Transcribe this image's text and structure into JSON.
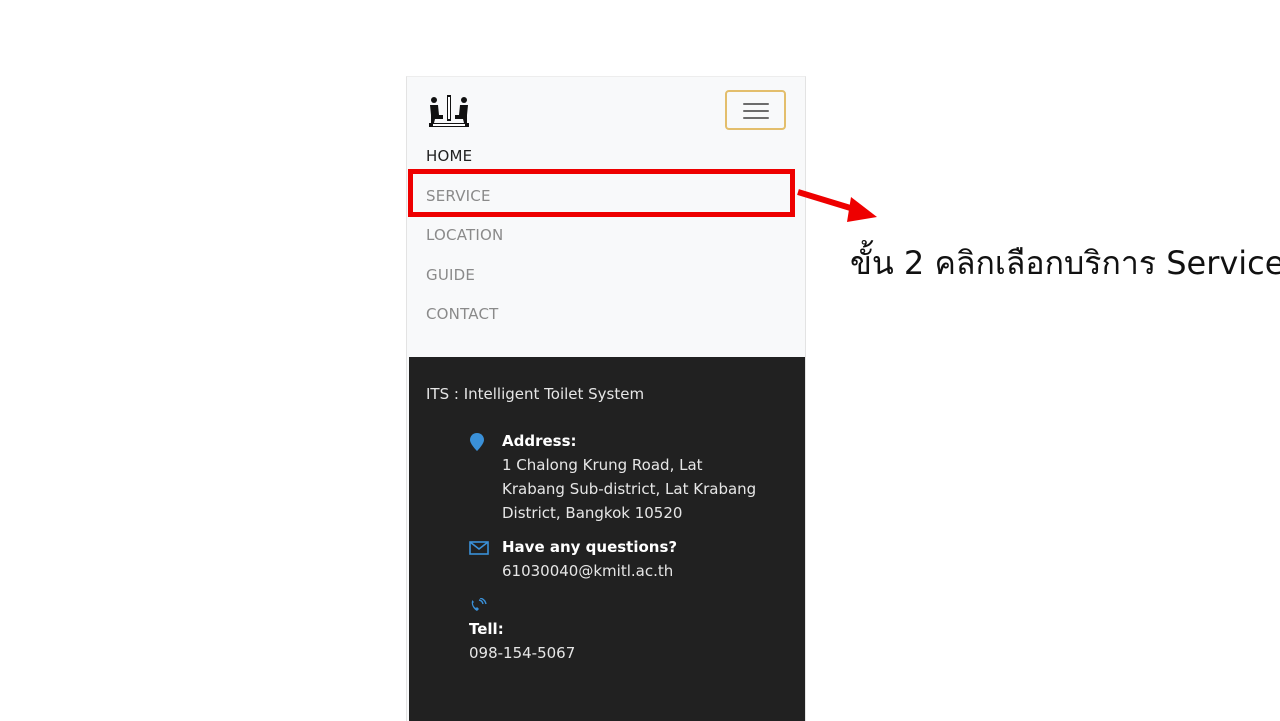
{
  "logo": {
    "icon": "toilet-logo-icon"
  },
  "navbar": {
    "toggler_icon": "hamburger-menu-icon",
    "items": [
      {
        "label": "HOME",
        "active": true
      },
      {
        "label": "SERVICE",
        "active": false
      },
      {
        "label": "LOCATION",
        "active": false
      },
      {
        "label": "GUIDE",
        "active": false
      },
      {
        "label": "CONTACT",
        "active": false
      }
    ]
  },
  "footer": {
    "brand": "ITS : Intelligent Toilet System",
    "address": {
      "icon": "map-pin-icon",
      "label": "Address:",
      "lines": [
        "1 Chalong Krung Road, Lat",
        "Krabang Sub-district, Lat Krabang",
        "District, Bangkok 10520"
      ]
    },
    "questions": {
      "icon": "envelope-icon",
      "label": "Have any questions?",
      "value": "61030040@kmitl.ac.th"
    },
    "tell": {
      "icon": "phone-icon",
      "label": "Tell:",
      "value": "098-154-5067"
    }
  },
  "annotation": {
    "text": "ขั้น 2 คลิกเลือกบริการ Service",
    "highlight_color": "#ee0000",
    "arrow_icon": "arrow-right-icon"
  },
  "colors": {
    "accent_border": "#e3be6c",
    "footer_bg": "#212121",
    "icon_blue": "#3a90d8"
  }
}
